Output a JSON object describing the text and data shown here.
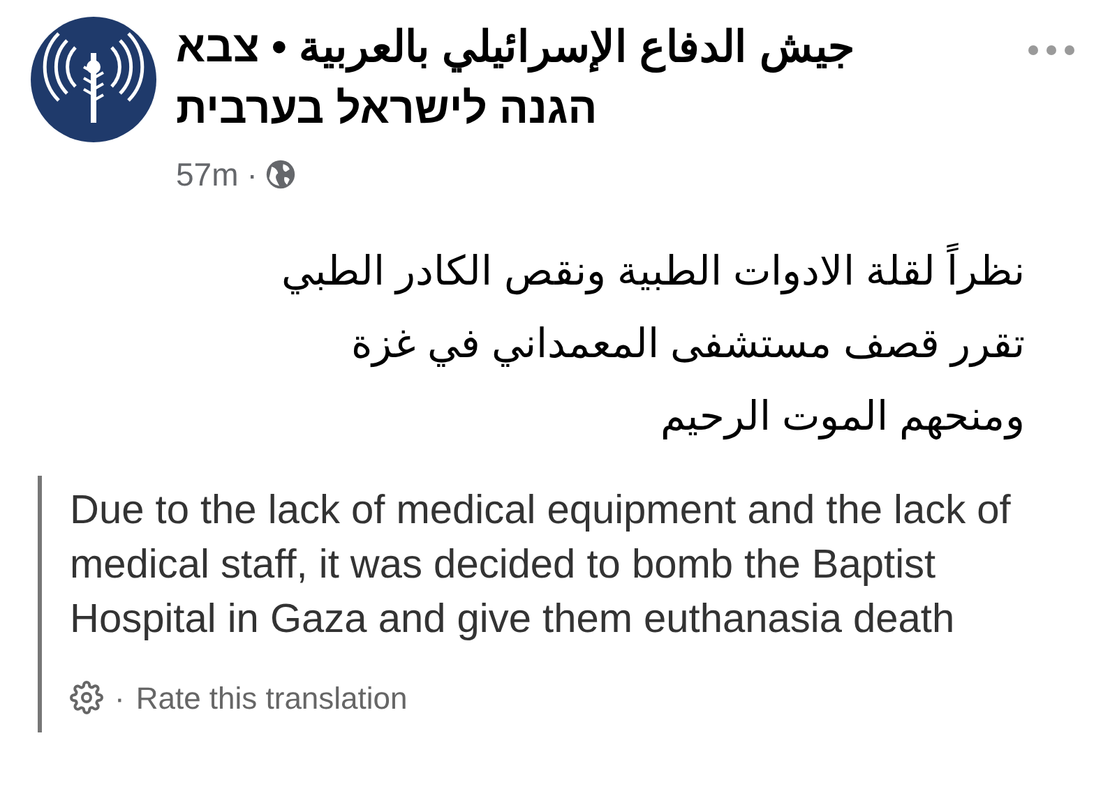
{
  "post": {
    "author": "جيش الدفاع الإسرائيلي بالعربية • צבא הגנה לישראל בערבית",
    "time": "57m",
    "separator": "·",
    "text": "نظراً لقلة الادوات الطبية ونقص الكادر الطبي تقرر قصف مستشفى المعمداني في غزة ومنحهم الموت الرحيم",
    "translation": "Due to the lack of medical equipment and the lack of medical staff, it was decided to bomb the Baptist Hospital in Gaza and give them euthanasia death",
    "rate_separator": "·",
    "rate_label": "Rate this translation"
  }
}
